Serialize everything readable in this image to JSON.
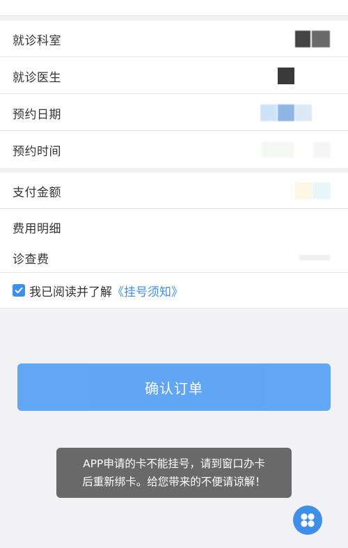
{
  "info_rows": [
    {
      "label": "就诊科室"
    },
    {
      "label": "就诊医生"
    },
    {
      "label": "预约日期"
    },
    {
      "label": "预约时间"
    }
  ],
  "payment_rows": [
    {
      "label": "支付金额"
    },
    {
      "label": "费用明细"
    },
    {
      "label": "诊查费"
    }
  ],
  "agreement": {
    "checked": true,
    "text": "我已阅读并了解",
    "link": "《挂号须知》"
  },
  "confirm_button": {
    "label": "确认订单"
  },
  "toast": {
    "line1": "APP申请的卡不能挂号，请到窗口办卡",
    "line2": "后重新绑卡。给您带来的不便请谅解！"
  },
  "colors": {
    "accent": "#3f8fe8",
    "button": "#5aa2f5",
    "background": "#f2f2f4"
  },
  "icons": {
    "checkbox": "check-icon",
    "floating": "four-circles-icon"
  }
}
